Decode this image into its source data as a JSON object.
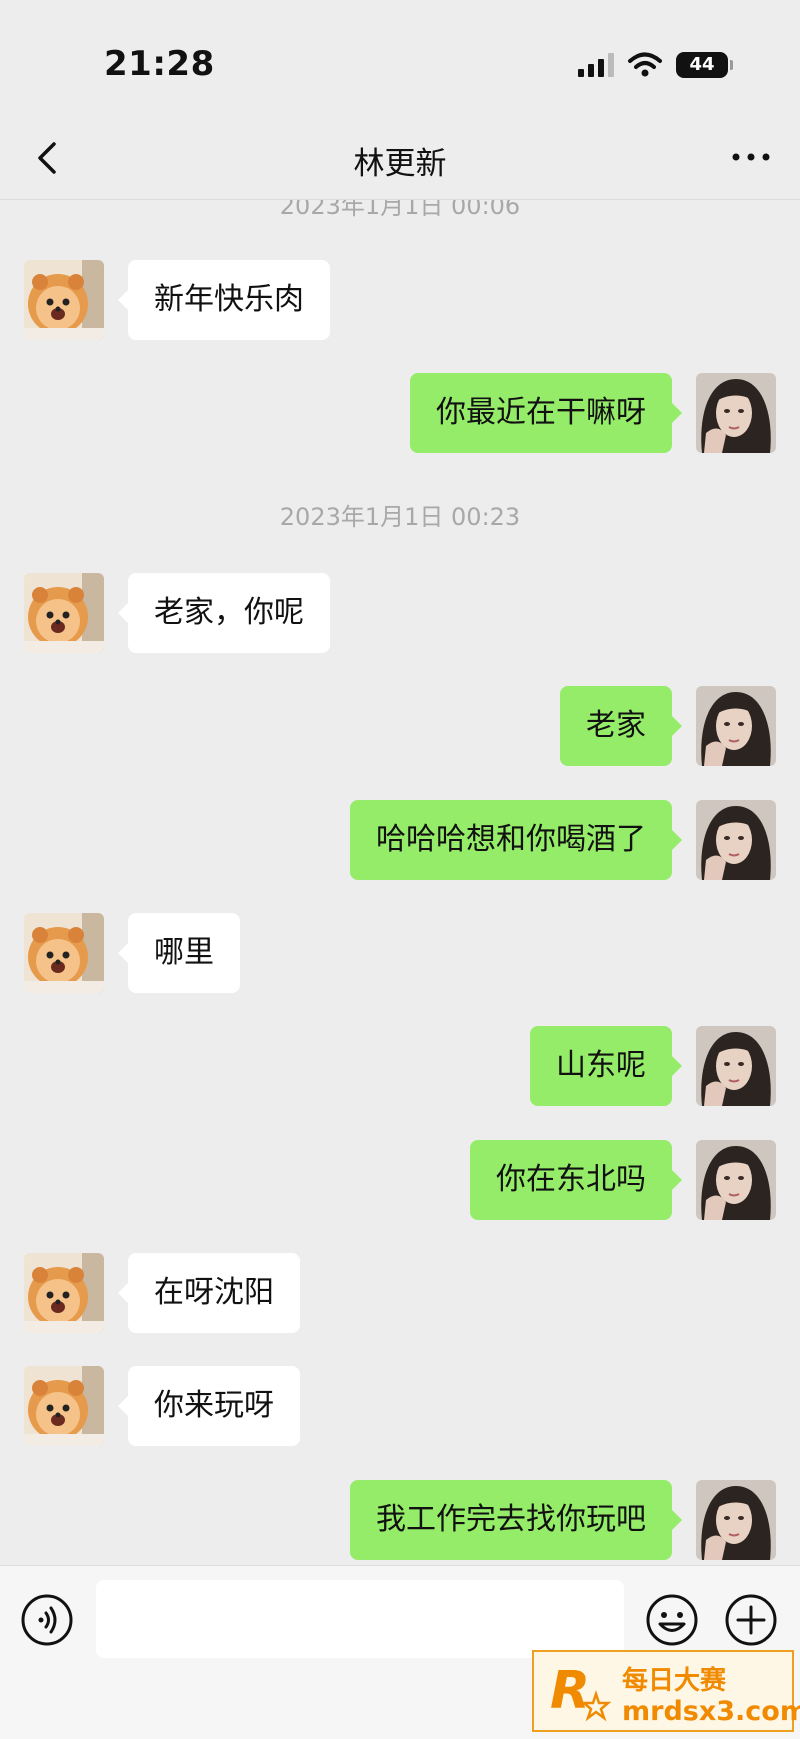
{
  "status_bar": {
    "time": "21:28",
    "battery": "44"
  },
  "header": {
    "title": "林更新"
  },
  "icons": {
    "back": "chevron-left-icon",
    "more": "ellipsis-icon",
    "voice": "voice-icon",
    "emoji": "emoji-icon",
    "plus": "plus-icon"
  },
  "colors": {
    "sent_bubble": "#95ec69",
    "received_bubble": "#ffffff",
    "background": "#ededed"
  },
  "chat": {
    "timestamps": [
      "2023年1月1日 00:06",
      "2023年1月1日 00:23"
    ],
    "messages": [
      {
        "side": "left",
        "text": "新年快乐肉"
      },
      {
        "side": "right",
        "text": "你最近在干嘛呀"
      },
      {
        "side": "left",
        "text": "老家，你呢"
      },
      {
        "side": "right",
        "text": "老家"
      },
      {
        "side": "right",
        "text": "哈哈哈想和你喝酒了"
      },
      {
        "side": "left",
        "text": "哪里"
      },
      {
        "side": "right",
        "text": "山东呢"
      },
      {
        "side": "right",
        "text": "你在东北吗"
      },
      {
        "side": "left",
        "text": "在呀沈阳"
      },
      {
        "side": "left",
        "text": "你来玩呀"
      },
      {
        "side": "right",
        "text": "我工作完去找你玩吧"
      }
    ]
  },
  "input": {
    "value": ""
  },
  "watermark": {
    "line1": "每日大赛",
    "line2": "mrdsx3.com",
    "logo_text": "R"
  }
}
